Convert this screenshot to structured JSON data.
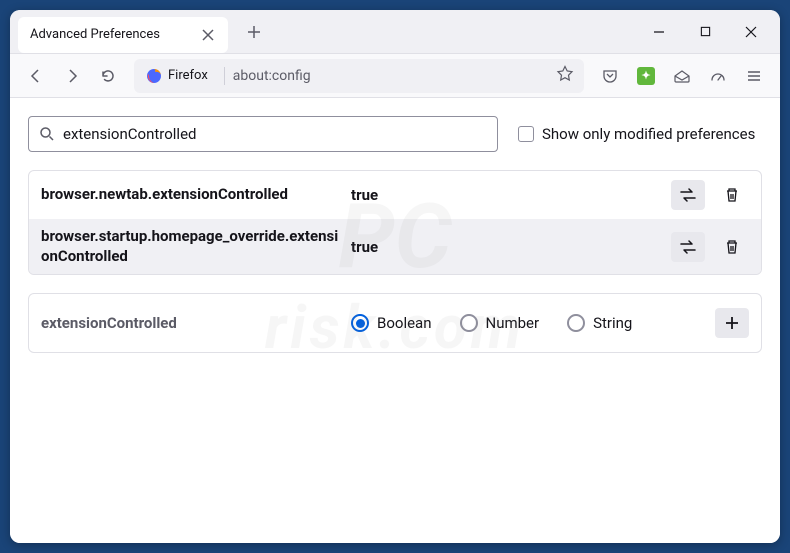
{
  "window": {
    "tab_title": "Advanced Preferences"
  },
  "toolbar": {
    "firefox_label": "Firefox",
    "url": "about:config"
  },
  "search": {
    "value": "extensionControlled",
    "checkbox_label": "Show only modified preferences"
  },
  "prefs": [
    {
      "name": "browser.newtab.extensionControlled",
      "value": "true"
    },
    {
      "name": "browser.startup.homepage_override.extensionControlled",
      "value": "true"
    }
  ],
  "create": {
    "name": "extensionControlled",
    "options": [
      "Boolean",
      "Number",
      "String"
    ],
    "selected": "Boolean"
  }
}
